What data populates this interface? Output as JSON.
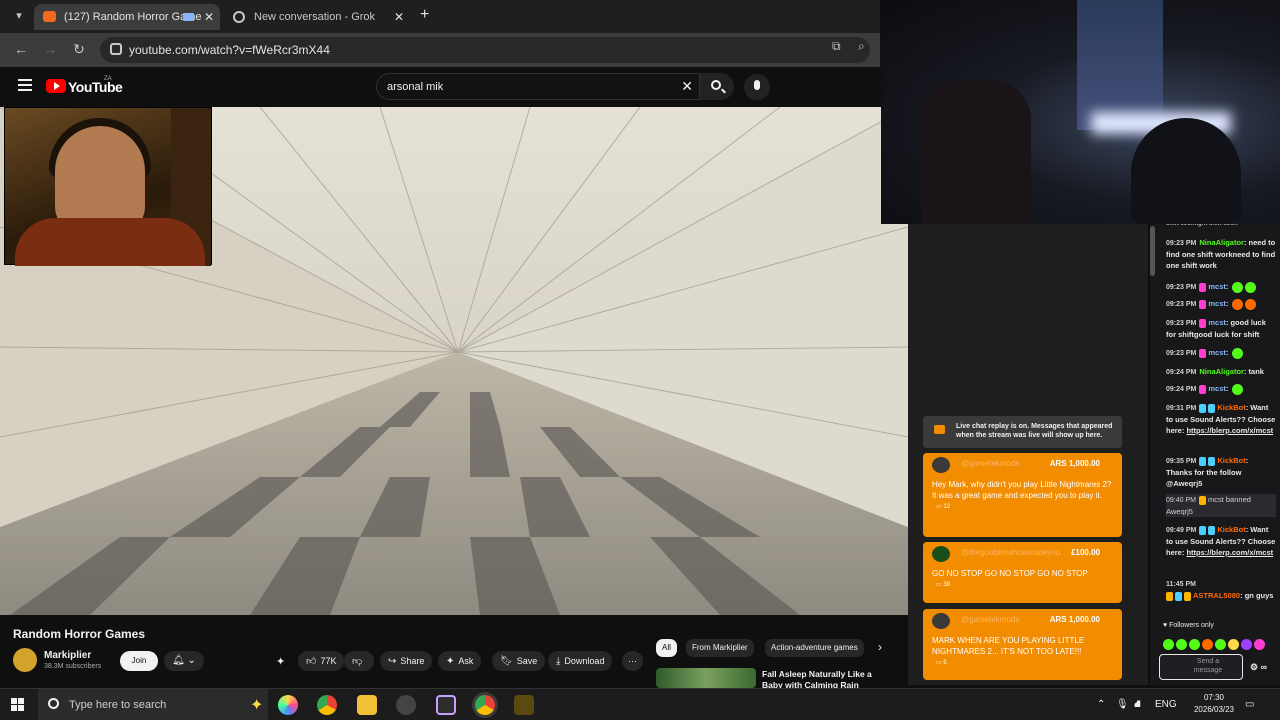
{
  "browser": {
    "tabs": [
      {
        "label": "(127) Random Horror Game",
        "active": true
      },
      {
        "label": "New conversation - Grok",
        "active": false
      }
    ],
    "new_tab_label": "+",
    "url": "youtube.com/watch?v=fWeRcr3mX44"
  },
  "youtube": {
    "logo_text": "YouTube",
    "logo_region": "ZA",
    "search_query": "arsonal mik",
    "video": {
      "title": "Random Horror Games",
      "channel": "Markiplier",
      "subscribers": "38.3M subscribers",
      "join_label": "Join",
      "likes": "77K",
      "share_label": "Share",
      "ask_label": "Ask",
      "save_label": "Save",
      "download_label": "Download"
    },
    "chips": [
      "All",
      "From Markiplier",
      "Action-adventure games"
    ],
    "recommendation": {
      "title": "Fall Asleep Naturally Like a Baby with Calming Rain Sound"
    }
  },
  "live_chat": {
    "notice": "Live chat replay is on. Messages that appeared when the stream was live will show up here.",
    "superchats": [
      {
        "user": "@gametekmods",
        "amount": "ARS 1,000.00",
        "message": "Hey Mark, why didn't you play Little Nightmares 2? It was a great game and expected you to play it.",
        "likes": "12"
      },
      {
        "user": "@thegoobenwhosensdeyou",
        "amount": "£100.00",
        "message": "GO NO STOP GO NO STOP GO NO STOP",
        "likes": "38"
      },
      {
        "user": "@gametekmods",
        "amount": "ARS 1,000.00",
        "message": "MARK WHEN ARE YOU PLAYING LITTLE NIGHTMARES 2... IT'S NOT TOO LATE!!!",
        "likes": "5"
      }
    ]
  },
  "kick_chat": {
    "top_fragment": "shift soomight shift soon",
    "messages": [
      {
        "time": "09:23 PM",
        "user": "NinaAligator",
        "text": "need to find one shift workneed to find one shift work"
      },
      {
        "time": "09:23 PM",
        "user": "mcst",
        "text": ""
      },
      {
        "time": "09:23 PM",
        "user": "mcst",
        "text": ""
      },
      {
        "time": "09:23 PM",
        "user": "mcst",
        "text": "good luck for shiftgood luck for shift"
      },
      {
        "time": "09:23 PM",
        "user": "mcst",
        "text": ""
      },
      {
        "time": "09:24 PM",
        "user": "NinaAligator",
        "text": "tank"
      },
      {
        "time": "09:24 PM",
        "user": "mcst",
        "text": ""
      },
      {
        "time": "09:31 PM",
        "user": "KickBot",
        "text": "Want to use Sound Alerts?? Choose here:",
        "link": "https://blerp.com/x/mcst"
      },
      {
        "time": "09:35 PM",
        "user": "KickBot",
        "text": "Thanks for the follow @Aweqrj5"
      },
      {
        "time": "09:40 PM",
        "user": "",
        "text": "mcst banned Aweqrj5"
      },
      {
        "time": "09:49 PM",
        "user": "KickBot",
        "text": "Want to use Sound Alerts?? Choose here:",
        "link": "https://blerp.com/x/mcst"
      },
      {
        "time": "11:45 PM",
        "user": "ASTRAL5080",
        "text": "gn guys"
      }
    ],
    "followers_only": "Followers only",
    "send_placeholder": "Send a message"
  },
  "taskbar": {
    "search_placeholder": "Type here to search",
    "language": "ENG",
    "time": "07:30",
    "date": "2026/03/23"
  }
}
